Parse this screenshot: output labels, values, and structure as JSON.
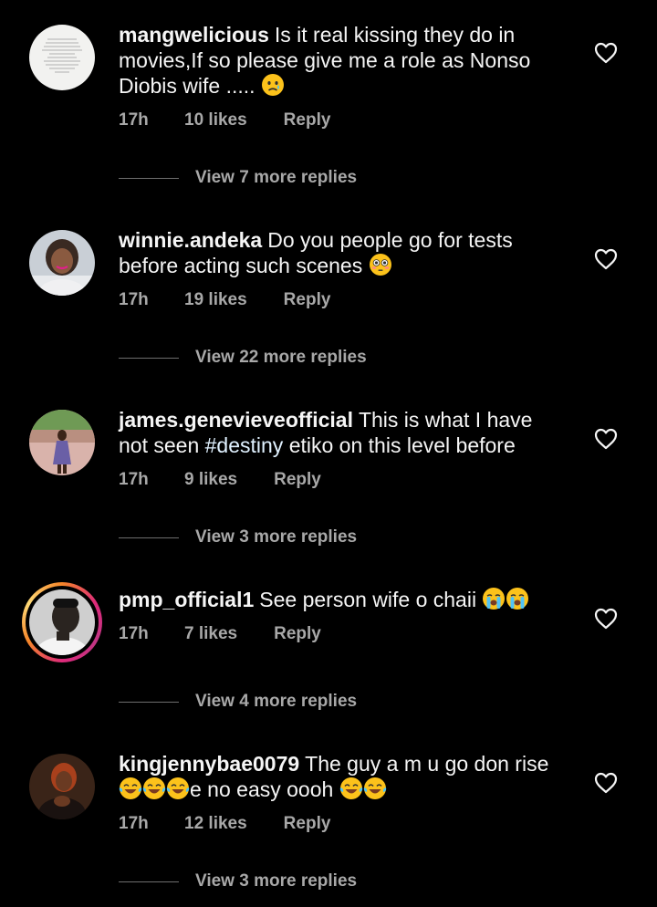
{
  "comments": [
    {
      "username": "mangwelicious",
      "text": "Is it real kissing they do in movies,If so please give me a role as Nonso Diobis wife .....",
      "time": "17h",
      "likes": "10 likes",
      "reply": "Reply",
      "view_replies": "View 7 more replies"
    },
    {
      "username": "winnie.andeka",
      "text": "Do you people go for tests before acting such scenes",
      "time": "17h",
      "likes": "19 likes",
      "reply": "Reply",
      "view_replies": "View 22 more replies"
    },
    {
      "username": "james.genevieveofficial",
      "text_before": "This is what I have not seen",
      "hashtag": "#destiny",
      "text_after": "etiko on this level before",
      "time": "17h",
      "likes": "9 likes",
      "reply": "Reply",
      "view_replies": "View 3 more replies"
    },
    {
      "username": "pmp_official1",
      "text": "See person wife o chaii",
      "time": "17h",
      "likes": "7 likes",
      "reply": "Reply",
      "view_replies": "View 4 more replies"
    },
    {
      "username": "kingjennybae0079",
      "text": "The guy a m u go don rise",
      "text_2": "e no easy oooh",
      "time": "17h",
      "likes": "12 likes",
      "reply": "Reply",
      "view_replies": "View 3 more replies"
    }
  ],
  "icons": {
    "like": "heart-outline-icon",
    "emoji_sad": "crying-face-emoji",
    "emoji_flushed": "flushed-face-emoji",
    "emoji_sob": "loudly-crying-face-emoji",
    "emoji_joy": "tears-of-joy-emoji"
  },
  "colors": {
    "background": "#000000",
    "text": "#f5f5f5",
    "meta": "#a8a8a8",
    "hashtag": "#e0f1ff",
    "divider": "#6e6e6e"
  }
}
